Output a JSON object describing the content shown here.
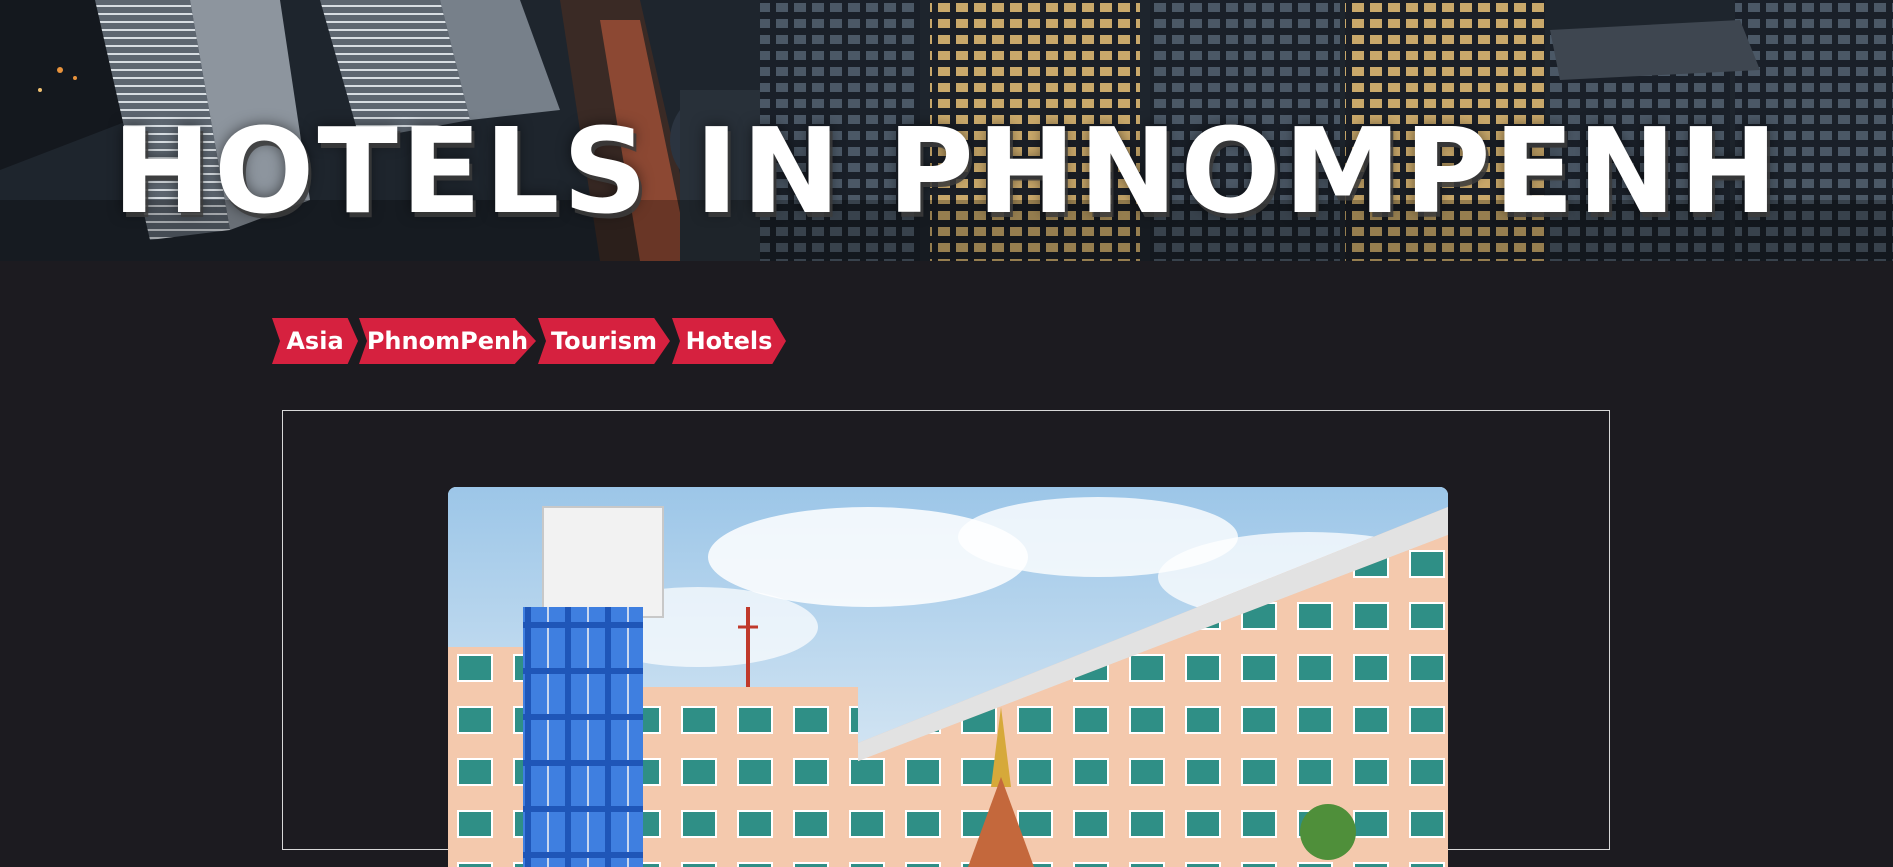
{
  "hero": {
    "title": "HOTELS IN PHNOMPENH"
  },
  "tags": [
    {
      "label": "Asia"
    },
    {
      "label": "PhnomPenh"
    },
    {
      "label": "Tourism"
    },
    {
      "label": "Hotels"
    }
  ],
  "colors": {
    "page_background": "#1c1b20",
    "tag_red": "#d6213f",
    "title_text": "#ffffff",
    "card_border": "#d8d8d8"
  }
}
